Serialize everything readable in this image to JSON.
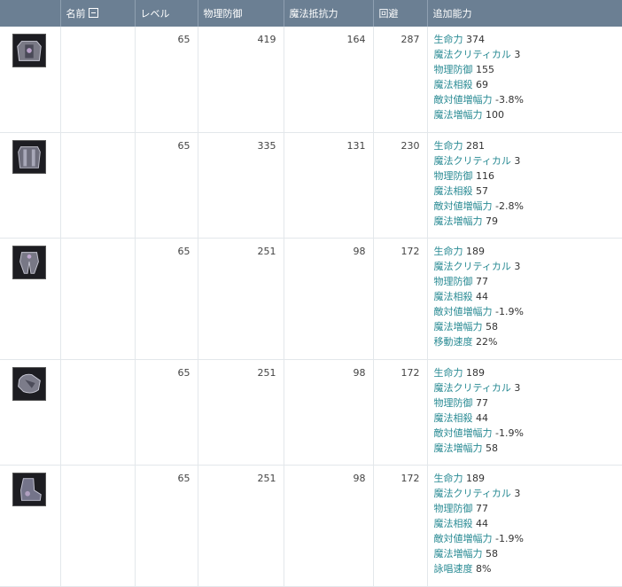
{
  "headers": [
    "名前",
    "レベル",
    "物理防御",
    "魔法抵抗力",
    "回避",
    "追加能力"
  ],
  "rows": [
    {
      "level": "65",
      "pdef": "419",
      "mres": "164",
      "evasion": "287",
      "stats": [
        {
          "k": "生命力",
          "v": "374"
        },
        {
          "k": "魔法クリティカル",
          "v": "3"
        },
        {
          "k": "物理防御",
          "v": "155"
        },
        {
          "k": "魔法相殺",
          "v": "69"
        },
        {
          "k": "敵対値増幅力",
          "v": "-3.8%"
        },
        {
          "k": "魔法増幅力",
          "v": "100"
        }
      ]
    },
    {
      "level": "65",
      "pdef": "335",
      "mres": "131",
      "evasion": "230",
      "stats": [
        {
          "k": "生命力",
          "v": "281"
        },
        {
          "k": "魔法クリティカル",
          "v": "3"
        },
        {
          "k": "物理防御",
          "v": "116"
        },
        {
          "k": "魔法相殺",
          "v": "57"
        },
        {
          "k": "敵対値増幅力",
          "v": "-2.8%"
        },
        {
          "k": "魔法増幅力",
          "v": "79"
        }
      ]
    },
    {
      "level": "65",
      "pdef": "251",
      "mres": "98",
      "evasion": "172",
      "stats": [
        {
          "k": "生命力",
          "v": "189"
        },
        {
          "k": "魔法クリティカル",
          "v": "3"
        },
        {
          "k": "物理防御",
          "v": "77"
        },
        {
          "k": "魔法相殺",
          "v": "44"
        },
        {
          "k": "敵対値増幅力",
          "v": "-1.9%"
        },
        {
          "k": "魔法増幅力",
          "v": "58"
        },
        {
          "k": "移動速度",
          "v": "22%"
        }
      ]
    },
    {
      "level": "65",
      "pdef": "251",
      "mres": "98",
      "evasion": "172",
      "stats": [
        {
          "k": "生命力",
          "v": "189"
        },
        {
          "k": "魔法クリティカル",
          "v": "3"
        },
        {
          "k": "物理防御",
          "v": "77"
        },
        {
          "k": "魔法相殺",
          "v": "44"
        },
        {
          "k": "敵対値増幅力",
          "v": "-1.9%"
        },
        {
          "k": "魔法増幅力",
          "v": "58"
        }
      ]
    },
    {
      "level": "65",
      "pdef": "251",
      "mres": "98",
      "evasion": "172",
      "stats": [
        {
          "k": "生命力",
          "v": "189"
        },
        {
          "k": "魔法クリティカル",
          "v": "3"
        },
        {
          "k": "物理防御",
          "v": "77"
        },
        {
          "k": "魔法相殺",
          "v": "44"
        },
        {
          "k": "敵対値増幅力",
          "v": "-1.9%"
        },
        {
          "k": "魔法増幅力",
          "v": "58"
        },
        {
          "k": "詠唱速度",
          "v": "8%"
        }
      ]
    }
  ],
  "icons": [
    "chest-armor-icon",
    "jacket-armor-icon",
    "pants-armor-icon",
    "gloves-armor-icon",
    "boots-armor-icon"
  ],
  "colors": {
    "header_bg": "#6b7f93",
    "stat_label": "#2a8b94"
  }
}
